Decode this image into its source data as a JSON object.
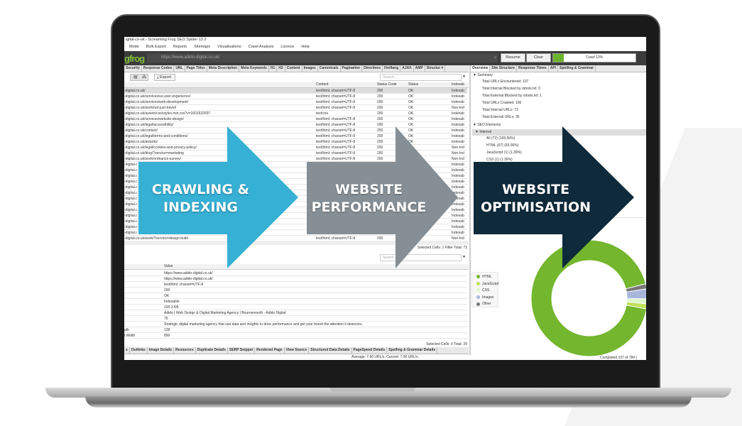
{
  "window": {
    "title": "igital-co-uk - Screaming Frog SEO Spider 13.2"
  },
  "menu": [
    "Mode",
    "Bulk Export",
    "Reports",
    "Sitemaps",
    "Visualisations",
    "Crawl Analysis",
    "Licence",
    "Help"
  ],
  "toolbar": {
    "logo": "gfrog",
    "url": "https://www.adido-digital.co.uk/",
    "resume": "Resume",
    "clear": "Clear",
    "progress_label": "Crawl 13%",
    "progress": 13
  },
  "left_tabs": [
    "Security",
    "Response Codes",
    "URL",
    "Page Titles",
    "Meta Description",
    "Meta Keywords",
    "H1",
    "H2",
    "Content",
    "Images",
    "Canonicals",
    "Pagination",
    "Directives",
    "Hreflang",
    "AJAX",
    "AMP",
    "Structur ▾"
  ],
  "left_toolbar": {
    "export": "Export",
    "search_placeholder": "Search..."
  },
  "table": {
    "headers": [
      "Content",
      "Status Code",
      "Status",
      "Indexab"
    ],
    "rows": [
      [
        "-digital.co.uk/",
        "text/html; charset=UTF-8",
        "200",
        "OK",
        "Indexab"
      ],
      [
        "-digital.co.uk/services/ux-user-experience/",
        "text/html; charset=UTF-8",
        "200",
        "OK",
        "Indexab"
      ],
      [
        "-digital.co.uk/services/web-development/",
        "text/html; charset=UTF-8",
        "200",
        "OK",
        "Indexab"
      ],
      [
        "-digital.co.uk/work/not-just-travel/",
        "text/html; charset=UTF-8",
        "200",
        "OK",
        "Non-Ind"
      ],
      [
        "-digital.co.uk/assets/css/styles.min.css?v=1601632697",
        "text/css",
        "200",
        "OK",
        "Indexab"
      ],
      [
        "-digital.co.uk/services/website-design/",
        "text/html; charset=UTF-8",
        "200",
        "OK",
        "Indexab"
      ],
      [
        "-digital.co.uk/legal/accessibility/",
        "text/html; charset=UTF-8",
        "200",
        "OK",
        "Indexab"
      ],
      [
        "-digital.co.uk/contact/",
        "text/html; charset=UTF-8",
        "200",
        "OK",
        "Indexab"
      ],
      [
        "-digital.co.uk/legal/terms-and-conditions/",
        "text/html; charset=UTF-8",
        "200",
        "OK",
        "Indexab"
      ],
      [
        "-digital.co.uk/awards/",
        "text/html; charset=UTF-8",
        "200",
        "OK",
        "Indexab"
      ],
      [
        "-digital.co.uk/legal/cookies-and-privacy-policy/",
        "text/html; charset=UTF-8",
        "200",
        "",
        "Non-Ind"
      ],
      [
        "-digital.co.uk/blog/?service=marketing",
        "text/html; charset=UTF-8",
        "200",
        "",
        "Non-Ind"
      ],
      [
        "-digital.co.uk/work/ordnance-survey/",
        "text/html; charset=UTF-8",
        "200",
        "",
        "Non-Ind"
      ],
      [
        "-digital.c",
        "",
        "",
        "",
        "Indexab"
      ],
      [
        "-digital.c",
        "",
        "",
        "",
        "Indexab"
      ],
      [
        "-digital.c",
        "",
        "",
        "",
        "Indexab"
      ],
      [
        "-digital.c",
        "",
        "",
        "",
        "Indexab"
      ],
      [
        "-digital.c",
        "",
        "",
        "",
        "Indexab"
      ],
      [
        "-digital.c",
        "",
        "",
        "",
        "Indexab"
      ],
      [
        "-digital.c",
        "",
        "",
        "",
        "Indexab"
      ],
      [
        "-digital.c",
        "",
        "",
        "",
        "Indexab"
      ],
      [
        "-digital.c",
        "",
        "",
        "",
        "Indexab"
      ],
      [
        "-digital.c",
        "",
        "",
        "",
        "Indexab"
      ],
      [
        "-digital.c",
        "",
        "",
        "",
        "Indexab"
      ],
      [
        "-digital.c",
        "",
        "",
        "",
        "Indexab"
      ],
      [
        "-digital.c",
        "",
        "",
        "",
        "Indexab"
      ],
      [
        "-digital.co.uk/work/?service=design-build",
        "text/html; charset=UTF-8",
        "200",
        "",
        "Non-Ind"
      ]
    ],
    "status": "Selected Cells: 1  Filter Total: 72"
  },
  "details": {
    "search_placeholder": "Search...",
    "value_header": "Value",
    "rows": [
      [
        "",
        "https://www.adido-digital.co.uk/"
      ],
      [
        "",
        "https://www.adido-digital.co.uk/"
      ],
      [
        "",
        "text/html; charset=UTF-8"
      ],
      [
        "",
        "200"
      ],
      [
        "",
        "OK"
      ],
      [
        "",
        "Indexable"
      ],
      [
        "",
        "100.3 KB"
      ],
      [
        "",
        "Adido | Web Design & Digital Marketing Agency | Bournemouth - Adido Digital"
      ],
      [
        "",
        "75"
      ],
      [
        "",
        "Strategic digital marketing agency that use data and insights to drive performance and get your brand the attention it deserves."
      ],
      [
        "gth",
        "128"
      ],
      [
        "l Width",
        "800"
      ]
    ],
    "status": "Selected Cells: 0  Total: 39",
    "tabs": [
      "s",
      "Outlinks",
      "Image Details",
      "Resources",
      "Duplicate Details",
      "SERP Snippet",
      "Rendered Page",
      "View Source",
      "Structured Data Details",
      "PageSpeed Details",
      "Spelling & Grammar Details"
    ]
  },
  "statusbar": {
    "speed": "Average: 7.60 URL/s. Current: 7.90 URL/s.",
    "completed": "Completed 107 of 784 ("
  },
  "right_tabs": [
    "Overview",
    "Site Structure",
    "Response Times",
    "API",
    "Spelling & Grammar"
  ],
  "summary": {
    "heading": "▼ Summary",
    "items": [
      "Total URLs Encountered: 107",
      "Total Internal Blocked by robots.txt: 0",
      "Total External Blocked by robots.txt: 1",
      "Total URLs Crawled: 106",
      "Total Internal URLs: 72",
      "Total External URLs: 35"
    ],
    "seo_heading": "▼ SEO Elements",
    "internal": "▼ Internal",
    "internal_items": [
      "All (72) (100.00%)",
      "HTML (67) (93.06%)",
      "JavaScript (1) (1.39%)",
      "CSS (1) (1.39%)"
    ]
  },
  "chart_data": {
    "type": "pie",
    "categories": [
      "HTML",
      "JavaScript",
      "CSS",
      "Images",
      "Other"
    ],
    "values": [
      93.06,
      1.39,
      1.39,
      2.78,
      1.38
    ],
    "colors": [
      "#74b62e",
      "#bfe05a",
      "#ddf6c8",
      "#a9b6dc",
      "#777777"
    ],
    "legend": "left"
  },
  "arrows": [
    {
      "label_line1": "CRAWLING &",
      "label_line2": "INDEXING",
      "color": "#36b0d4"
    },
    {
      "label_line1": "WEBSITE",
      "label_line2": "PERFORMANCE",
      "color": "#858f95"
    },
    {
      "label_line1": "WEBSITE",
      "label_line2": "OPTIMISATION",
      "color": "#0e2a3b"
    }
  ]
}
